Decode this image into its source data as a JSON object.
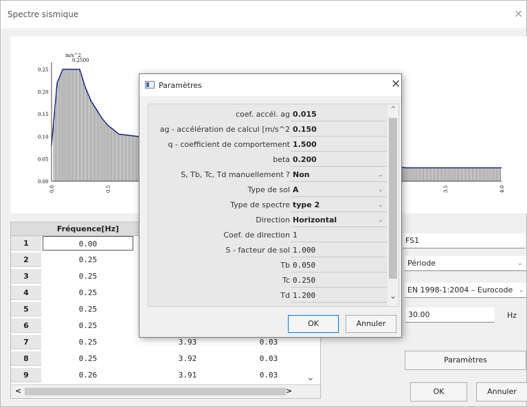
{
  "window": {
    "title": "Spectre sismique",
    "close": "×"
  },
  "chart_data": {
    "type": "bar",
    "ylabel": "m/s^2",
    "peak_label": "0.2500",
    "y_ticks": [
      "0.25",
      "0.20",
      "0.15",
      "0.10",
      "0.05",
      "0.00"
    ],
    "x_ticks_visible": [
      "0.0",
      "0.5",
      "3.5",
      "4.0"
    ],
    "ylim": [
      0,
      0.25
    ],
    "xlim": [
      0,
      4.0
    ],
    "x": [
      0.0,
      0.05,
      0.1,
      0.15,
      0.2,
      0.25,
      0.3,
      0.35,
      0.4,
      0.45,
      0.5,
      0.55,
      0.6,
      3.15,
      3.5,
      4.0
    ],
    "values": [
      0.08,
      0.22,
      0.25,
      0.25,
      0.25,
      0.25,
      0.21,
      0.18,
      0.16,
      0.14,
      0.125,
      0.115,
      0.105,
      0.03,
      0.03,
      0.03
    ],
    "grid": false
  },
  "grid": {
    "headers": [
      "Fréquence[Hz]"
    ],
    "rows": [
      {
        "n": "1",
        "freq": "0.00",
        "a": "",
        "b": ""
      },
      {
        "n": "2",
        "freq": "0.25",
        "a": "",
        "b": ""
      },
      {
        "n": "3",
        "freq": "0.25",
        "a": "",
        "b": ""
      },
      {
        "n": "4",
        "freq": "0.25",
        "a": "",
        "b": ""
      },
      {
        "n": "5",
        "freq": "0.25",
        "a": "",
        "b": ""
      },
      {
        "n": "6",
        "freq": "0.25",
        "a": "",
        "b": ""
      },
      {
        "n": "7",
        "freq": "0.25",
        "a": "3.93",
        "b": "0.03"
      },
      {
        "n": "8",
        "freq": "0.25",
        "a": "3.92",
        "b": "0.03"
      },
      {
        "n": "9",
        "freq": "0.26",
        "a": "3.91",
        "b": "0.03"
      }
    ],
    "scroll_left": "<",
    "scroll_right": ">",
    "scroll_down": "⌄"
  },
  "right_panel": {
    "name_value": "FS1",
    "type_value": "Période",
    "code_value": "EN 1998-1:2004 – Eurocode",
    "number_value": "30.00",
    "unit": "Hz",
    "params_button": "Paramètres",
    "ok_button": "OK",
    "cancel_button": "Annuler"
  },
  "dialog": {
    "title": "Paramètres",
    "close": "×",
    "properties": [
      {
        "label": "coef. accél. ag",
        "value": "0.015",
        "style": "bold",
        "dropdown": false
      },
      {
        "label": "ag - accélération de calcul [m/s^2",
        "value": "0.150",
        "style": "bold",
        "dropdown": false
      },
      {
        "label": "q - coefficient de comportement",
        "value": "1.500",
        "style": "bold",
        "dropdown": false
      },
      {
        "label": "beta",
        "value": "0.200",
        "style": "bold",
        "dropdown": false
      },
      {
        "label": "S, Tb, Tc, Td manuellement ?",
        "value": "Non",
        "style": "bold",
        "dropdown": true
      },
      {
        "label": "Type de sol",
        "value": "A",
        "style": "bold",
        "dropdown": true
      },
      {
        "label": "Type de spectre",
        "value": "type 2",
        "style": "bold",
        "dropdown": true
      },
      {
        "label": "Direction",
        "value": "Horizontal",
        "style": "bold",
        "dropdown": true
      },
      {
        "label": "Coef. de direction",
        "value": "1",
        "style": "mono",
        "dropdown": false
      },
      {
        "label": "S - facteur de sol",
        "value": "1.000",
        "style": "mono",
        "dropdown": false
      },
      {
        "label": "Tb",
        "value": "0.050",
        "style": "mono",
        "dropdown": false
      },
      {
        "label": "Tc",
        "value": "0.250",
        "style": "mono",
        "dropdown": false
      },
      {
        "label": "Td",
        "value": "1.200",
        "style": "mono",
        "dropdown": false
      }
    ],
    "scroll_up": "^",
    "scroll_down": "⌄",
    "ok_button": "OK",
    "cancel_button": "Annuler"
  }
}
